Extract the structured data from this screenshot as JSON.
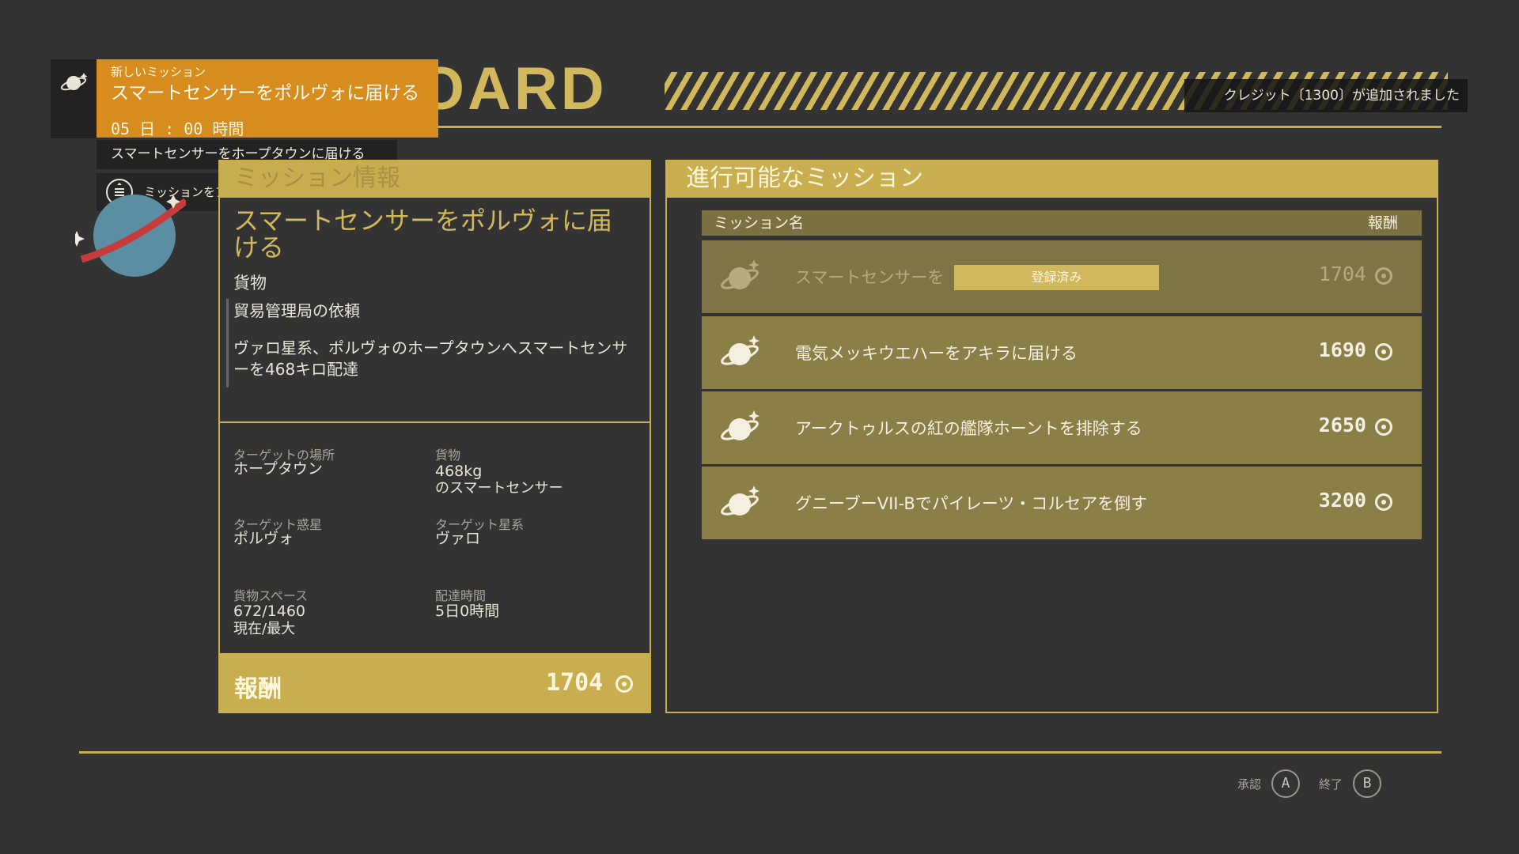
{
  "header": {
    "title": "MISSION BOARD",
    "credit_toast": "クレジット〔1300〕が追加されました"
  },
  "notification": {
    "small": "新しいミッション",
    "title": "スマートセンサーをポルヴォに届ける",
    "time": "05 日 : 00 時間",
    "sub": "スマートセンサーをホープタウンに届ける",
    "active": "ミッションをアクティブに設定"
  },
  "mission_info": {
    "header": "ミッション情報",
    "title": "スマートセンサーをポルヴォに届ける",
    "type": "貨物",
    "client": "貿易管理局の依頼",
    "description": "ヴァロ星系、ポルヴォのホープタウンへスマートセンサーを468キロ配達",
    "details": {
      "target_location_label": "ターゲットの場所",
      "target_location": "ホープタウン",
      "cargo_label": "貨物",
      "cargo_line1": "468kg",
      "cargo_line2": "のスマートセンサー",
      "target_planet_label": "ターゲット惑星",
      "target_planet": "ポルヴォ",
      "target_system_label": "ターゲット星系",
      "target_system": "ヴァロ",
      "cargo_space_label": "貨物スペース",
      "cargo_space": "672/1460",
      "cargo_space_sub": "現在/最大",
      "delivery_time_label": "配達時間",
      "delivery_time": "5日0時間"
    },
    "reward_label": "報酬",
    "reward_value": "1704"
  },
  "available": {
    "header": "進行可能なミッション",
    "col_name": "ミッション名",
    "col_reward": "報酬",
    "rows": [
      {
        "name": "スマートセンサーを",
        "badge": "登録済み",
        "reward": "1704"
      },
      {
        "name": "電気メッキウエハーをアキラに届ける",
        "reward": "1690"
      },
      {
        "name": "アークトゥルスの紅の艦隊ホーントを排除する",
        "reward": "2650"
      },
      {
        "name": "グニーブーVII-Bでパイレーツ・コルセアを倒す",
        "reward": "3200"
      }
    ]
  },
  "footer": {
    "accept_label": "承認",
    "accept_key": "A",
    "exit_label": "終了",
    "exit_key": "B"
  },
  "colors": {
    "accent_gold": "#c9ae4f",
    "notification_orange": "#d68d1e",
    "background": "#333333"
  },
  "icons": [
    "planet-icon",
    "credit-icon",
    "menu-icon"
  ]
}
